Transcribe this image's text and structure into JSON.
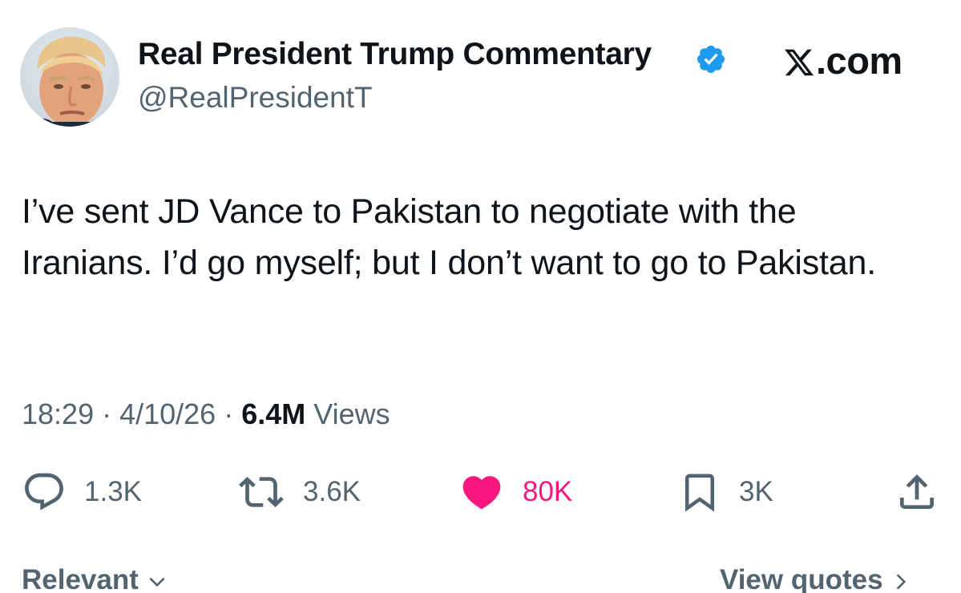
{
  "author": {
    "display_name": "Real President Trump Commentary",
    "handle": "@RealPresidentT",
    "verified": true,
    "avatar_icon": "profile-photo"
  },
  "brand": {
    "label": ".com",
    "icon": "x-logo-icon"
  },
  "tweet": {
    "text": "I’ve sent JD Vance to Pakistan to negotiate with the Iranians. I’d go myself; but I don’t want to go to Pakistan."
  },
  "meta": {
    "time": "18:29",
    "separator": " · ",
    "date": "4/10/26",
    "views_count": "6.4M",
    "views_label": " Views"
  },
  "actions": {
    "replies": "1.3K",
    "reposts": "3.6K",
    "likes": "80K",
    "bookmarks": "3K"
  },
  "footer": {
    "sort_label": "Relevant",
    "quotes_label": "View quotes"
  },
  "colors": {
    "text": "#0f1419",
    "secondary": "#536471",
    "verified": "#1d9bf0",
    "like": "#f91880"
  }
}
